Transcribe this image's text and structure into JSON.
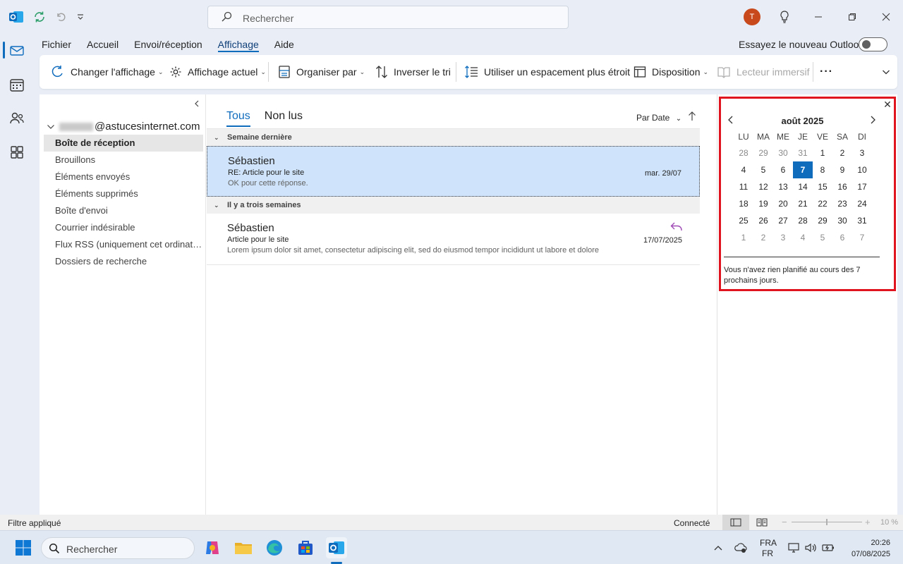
{
  "search": {
    "placeholder": "Rechercher"
  },
  "user": {
    "initial": "T"
  },
  "menu": {
    "tabs": [
      "Fichier",
      "Accueil",
      "Envoi/réception",
      "Affichage",
      "Aide"
    ],
    "active_tab": "Affichage",
    "try_new_label": "Essayez le nouveau Outlook"
  },
  "ribbon": {
    "change_view": "Changer l'affichage",
    "current_view": "Affichage actuel",
    "arrange_by": "Organiser par",
    "reverse_sort": "Inverser le tri",
    "narrow_spacing": "Utiliser un espacement plus étroit",
    "layout": "Disposition",
    "immersive_reader": "Lecteur immersif",
    "more": "···"
  },
  "folders": {
    "account_suffix": "@astucesinternet.com",
    "items": [
      "Boîte de réception",
      "Brouillons",
      "Éléments envoyés",
      "Éléments supprimés",
      "Boîte d'envoi",
      "Courrier indésirable",
      "Flux RSS (uniquement cet ordinate...",
      "Dossiers de recherche"
    ]
  },
  "msglist": {
    "tab_all": "Tous",
    "tab_unread": "Non lus",
    "sort_label": "Par Date",
    "groups": [
      {
        "title": "Semaine dernière",
        "messages": [
          {
            "from": "Sébastien",
            "subject": "RE: Article pour le site",
            "preview": "OK pour cette réponse.",
            "date": "mar. 29/07"
          }
        ]
      },
      {
        "title": "Il y a trois semaines",
        "messages": [
          {
            "from": "Sébastien",
            "subject": "Article pour le site",
            "preview": "Lorem ipsum dolor sit amet, consectetur adipiscing elit, sed do eiusmod tempor incididunt ut labore et dolore",
            "date": "17/07/2025"
          }
        ]
      }
    ]
  },
  "calendar": {
    "month_title": "août 2025",
    "weekdays": [
      "LU",
      "MA",
      "ME",
      "JE",
      "VE",
      "SA",
      "DI"
    ],
    "weeks": [
      [
        "28",
        "29",
        "30",
        "31",
        "1",
        "2",
        "3"
      ],
      [
        "4",
        "5",
        "6",
        "7",
        "8",
        "9",
        "10"
      ],
      [
        "11",
        "12",
        "13",
        "14",
        "15",
        "16",
        "17"
      ],
      [
        "18",
        "19",
        "20",
        "21",
        "22",
        "23",
        "24"
      ],
      [
        "25",
        "26",
        "27",
        "28",
        "29",
        "30",
        "31"
      ],
      [
        "1",
        "2",
        "3",
        "4",
        "5",
        "6",
        "7"
      ]
    ],
    "today": "7",
    "note": "Vous n'avez rien planifié au cours des 7 prochains jours."
  },
  "status": {
    "filter": "Filtre appliqué",
    "connection": "Connecté",
    "zoom": "10 %"
  },
  "taskbar": {
    "search_placeholder": "Rechercher",
    "lang_top": "FRA",
    "lang_bottom": "FR",
    "time": "20:26",
    "date": "07/08/2025"
  },
  "colors": {
    "accent": "#0f6cbd",
    "highlight_box": "#e0141e",
    "selected_row": "#cfe4fa"
  }
}
